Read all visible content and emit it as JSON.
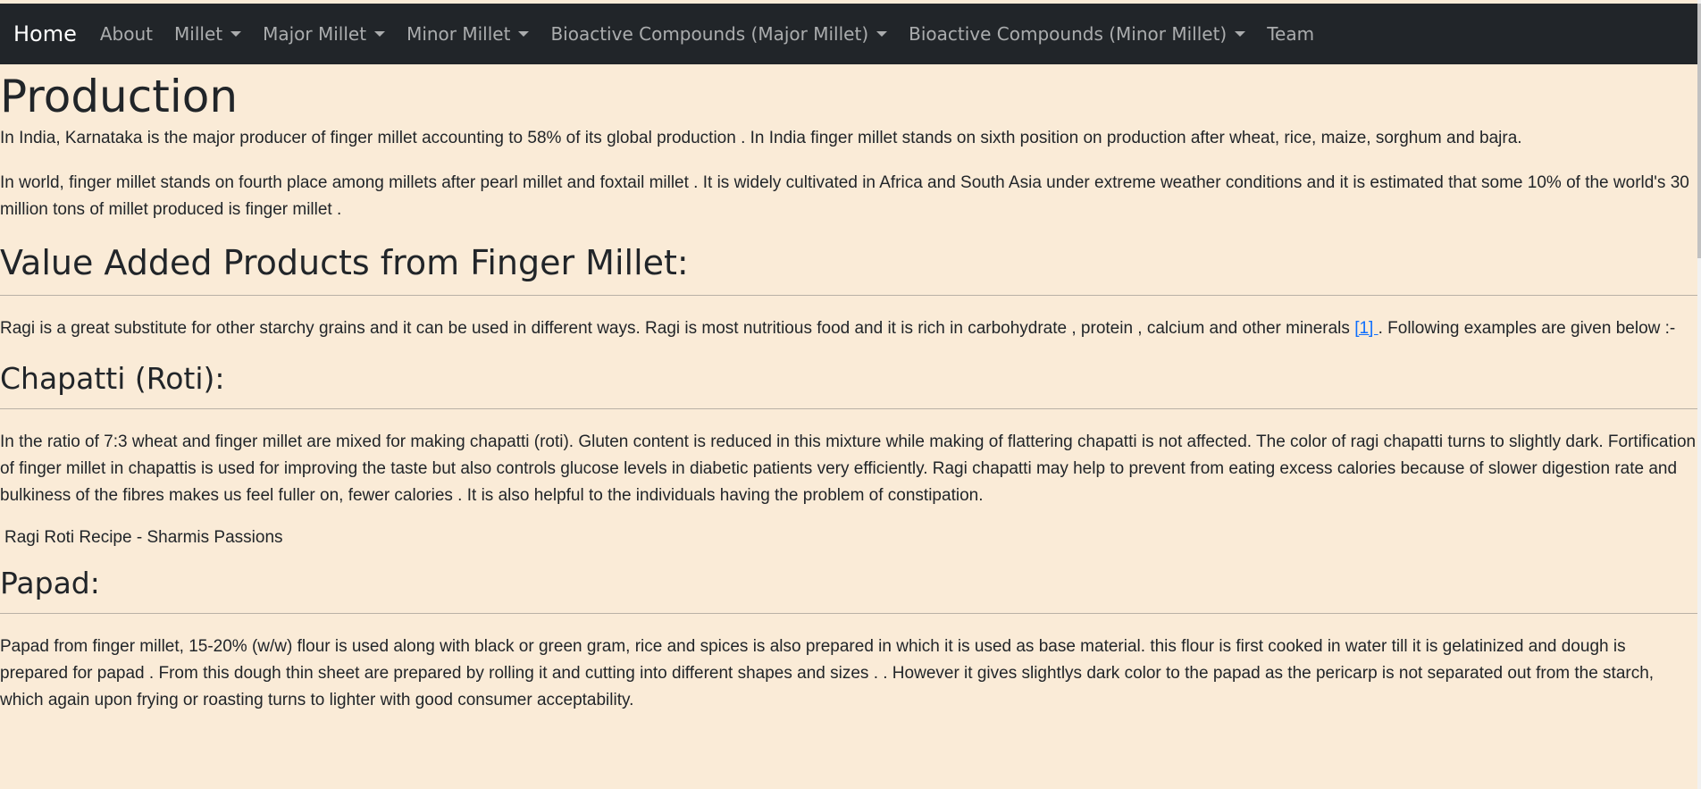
{
  "nav": {
    "brand": "Home",
    "items": [
      {
        "label": "About",
        "dropdown": false
      },
      {
        "label": "Millet",
        "dropdown": true
      },
      {
        "label": "Major Millet",
        "dropdown": true
      },
      {
        "label": "Minor Millet",
        "dropdown": true
      },
      {
        "label": "Bioactive Compounds (Major Millet)",
        "dropdown": true
      },
      {
        "label": "Bioactive Compounds (Minor Millet)",
        "dropdown": true
      },
      {
        "label": "Team",
        "dropdown": false
      }
    ]
  },
  "production": {
    "heading": "Production",
    "p1": "In India, Karnataka is the major producer of finger millet accounting to 58% of its global production . In India finger millet stands on sixth position on production after wheat, rice, maize, sorghum and bajra.",
    "p2": "In world, finger millet stands on fourth place among millets after pearl millet and foxtail millet . It is widely cultivated in Africa and South Asia under extreme weather conditions and it is estimated that some 10% of the world's 30 million tons of millet produced is finger millet ."
  },
  "value_added": {
    "heading": "Value Added Products from Finger Millet:",
    "text_before": "Ragi is a great substitute for other starchy grains and it can be used in different ways. Ragi is most nutritious food and it is rich in carbohydrate , protein , calcium and other minerals ",
    "ref": "[1] ",
    "text_after": ". Following examples are given below :-"
  },
  "chapatti": {
    "heading": "Chapatti (Roti):",
    "text": "In the ratio of 7:3 wheat and finger millet are mixed for making chapatti (roti). Gluten content is reduced in this mixture while making of flattering chapatti is not affected. The color of ragi chapatti turns to slightly dark. Fortification of finger millet in chapattis is used for improving the taste but also controls glucose levels in diabetic patients very efficiently. Ragi chapatti may help to prevent from eating excess calories because of slower digestion rate and bulkiness of the fibres makes us feel fuller on, fewer calories . It is also helpful to the individuals having the problem of constipation.",
    "image_alt": "Ragi Roti Recipe - Sharmis Passions"
  },
  "papad": {
    "heading": "Papad:",
    "text": "Papad from finger millet, 15-20% (w/w) flour is used along with black or green gram, rice and spices is also prepared in which it is used as base material. this flour is first cooked in water till it is gelatinized and dough is prepared for papad . From this dough thin sheet are prepared by rolling it and cutting into different shapes and sizes . . However it gives slightlys dark color to the papad as the pericarp is not separated out from the starch, which again upon frying or roasting turns to lighter with good consumer acceptability."
  },
  "colors": {
    "background": "#faebd7",
    "navbar": "#212529",
    "link": "#0d6efd"
  }
}
